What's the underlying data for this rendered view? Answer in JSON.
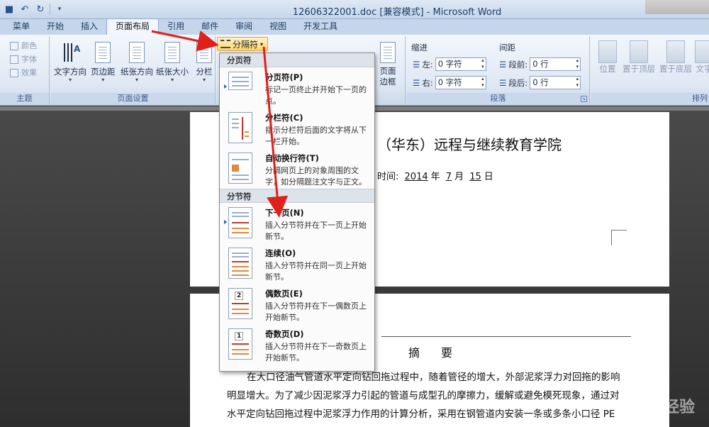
{
  "window": {
    "title": "12606322001.doc [兼容模式] - Microsoft Word"
  },
  "tabs": [
    "菜单",
    "开始",
    "插入",
    "页面布局",
    "引用",
    "邮件",
    "审阅",
    "视图",
    "开发工具"
  ],
  "active_tab": "页面布局",
  "ribbon": {
    "theme_group": {
      "items": [
        "颜色",
        "字体",
        "效果"
      ],
      "label": "主题"
    },
    "page_setup_group": {
      "buttons": [
        "文字方向",
        "页边距",
        "纸张方向",
        "纸张大小",
        "分栏"
      ],
      "label": "页面设置",
      "breaks_button": "分隔符"
    },
    "background_group": {
      "page_border": "页面边框"
    },
    "paragraph_group": {
      "label": "段落",
      "indent_head": "缩进",
      "spacing_head": "间距",
      "indent_left_label": "左:",
      "indent_left_value": "0 字符",
      "indent_right_label": "右:",
      "indent_right_value": "0 字符",
      "space_before_label": "段前:",
      "space_before_value": "0 行",
      "space_after_label": "段后:",
      "space_after_value": "0 行"
    },
    "arrange_group": {
      "buttons": [
        "位置",
        "置于顶层",
        "置于底层",
        "文字"
      ],
      "label": "排列"
    }
  },
  "breaks_menu": {
    "page_breaks_head": "分页符",
    "section_breaks_head": "分节符",
    "page_items": [
      {
        "title": "分页符(P)",
        "desc": "标记一页终止并开始下一页的点。"
      },
      {
        "title": "分栏符(C)",
        "desc": "指示分栏符后面的文字将从下一栏开始。"
      },
      {
        "title": "自动换行符(T)",
        "desc": "分隔网页上的对象周围的文字，如分隔题注文字与正文。"
      }
    ],
    "section_items": [
      {
        "title": "下一页(N)",
        "desc": "插入分节符并在下一页上开始新节。"
      },
      {
        "title": "连续(O)",
        "desc": "插入分节符并在同一页上开始新节。"
      },
      {
        "title": "偶数页(E)",
        "desc": "插入分节符并在下一偶数页上开始新节。",
        "num": "2"
      },
      {
        "title": "奇数页(D)",
        "desc": "插入分节符并在下一奇数页上开始新节。",
        "num": "1"
      }
    ]
  },
  "document": {
    "page1_title": "（华东）远程与继续教育学院",
    "date_label": "时间:",
    "year": "2014",
    "year_unit": "年",
    "month": "7",
    "month_unit": "月",
    "day": "15",
    "day_unit": "日",
    "abstract_title": "摘要",
    "body_lines": [
      "在大口径油气管道水平定向钻回拖过程中，随着管径的增大，外部泥浆浮力对回拖的影响",
      "明显增大。为了减少因泥浆浮力引起的管道与成型孔的摩擦力，缓解或避免模死现象，通过对",
      "水平定向钻回拖过程中泥浆浮力作用的计算分析，采用在钢管道内安装一条或多条小口径 PE"
    ]
  },
  "watermark": "经验"
}
